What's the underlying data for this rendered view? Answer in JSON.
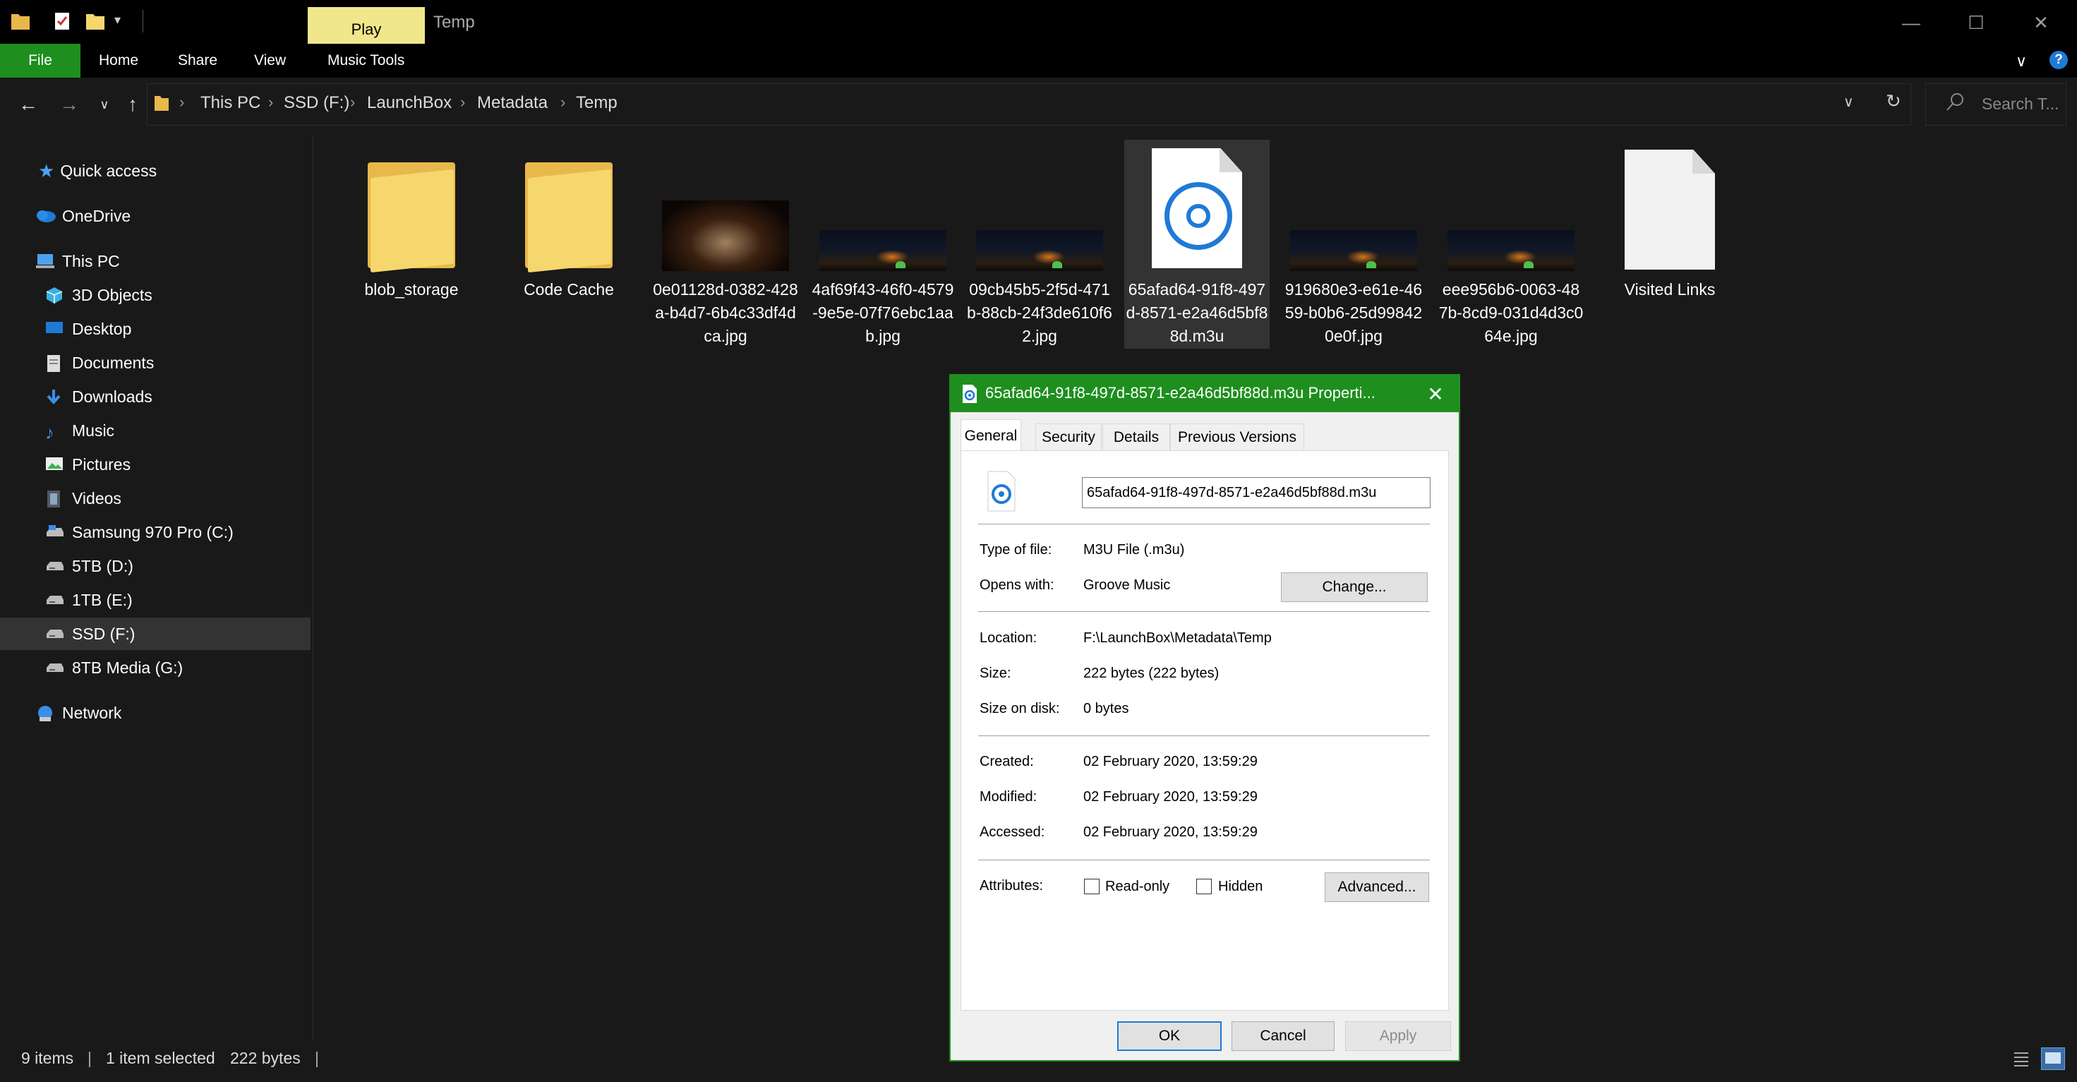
{
  "window": {
    "title": "Temp",
    "contextual_tab": "Play",
    "controls": [
      "minimize",
      "maximize",
      "close"
    ]
  },
  "ribbon": {
    "tabs": [
      "File",
      "Home",
      "Share",
      "View",
      "Music Tools"
    ]
  },
  "address": {
    "crumbs": [
      "This PC",
      "SSD (F:)",
      "LaunchBox",
      "Metadata",
      "Temp"
    ],
    "search_placeholder": "Search T..."
  },
  "sidebar": {
    "items": [
      {
        "label": "Quick access",
        "icon": "star-icon"
      },
      {
        "label": "OneDrive",
        "icon": "cloud-icon"
      },
      {
        "label": "This PC",
        "icon": "computer-icon"
      },
      {
        "label": "3D Objects",
        "icon": "cube-icon"
      },
      {
        "label": "Desktop",
        "icon": "desktop-icon"
      },
      {
        "label": "Documents",
        "icon": "documents-icon"
      },
      {
        "label": "Downloads",
        "icon": "download-arrow-icon"
      },
      {
        "label": "Music",
        "icon": "music-note-icon"
      },
      {
        "label": "Pictures",
        "icon": "pictures-icon"
      },
      {
        "label": "Videos",
        "icon": "film-icon"
      },
      {
        "label": "Samsung 970 Pro (C:)",
        "icon": "drive-icon"
      },
      {
        "label": "5TB (D:)",
        "icon": "drive-icon"
      },
      {
        "label": "1TB (E:)",
        "icon": "drive-icon"
      },
      {
        "label": "SSD (F:)",
        "icon": "drive-icon",
        "selected": true
      },
      {
        "label": "8TB Media (G:)",
        "icon": "drive-icon"
      },
      {
        "label": "Network",
        "icon": "network-icon"
      }
    ]
  },
  "files": [
    {
      "name": "blob_storage",
      "kind": "folder"
    },
    {
      "name": "Code Cache",
      "kind": "folder"
    },
    {
      "name": "0e01128d-0382-428a-b4d7-6b4c33df4dca.jpg",
      "kind": "image"
    },
    {
      "name": "4af69f43-46f0-4579-9e5e-07f76ebc1aab.jpg",
      "kind": "image"
    },
    {
      "name": "09cb45b5-2f5d-471b-88cb-24f3de610f62.jpg",
      "kind": "image"
    },
    {
      "name": "65afad64-91f8-497d-8571-e2a46d5bf88d.m3u",
      "kind": "playlist",
      "selected": true
    },
    {
      "name": "919680e3-e61e-4659-b0b6-25d998420e0f.jpg",
      "kind": "image"
    },
    {
      "name": "eee956b6-0063-487b-8cd9-031d4d3c064e.jpg",
      "kind": "image"
    },
    {
      "name": "Visited Links",
      "kind": "file"
    }
  ],
  "status": {
    "count": "9 items",
    "selection": "1 item selected",
    "size": "222 bytes"
  },
  "dialog": {
    "title": "65afad64-91f8-497d-8571-e2a46d5bf88d.m3u Properti...",
    "tabs": [
      "General",
      "Security",
      "Details",
      "Previous Versions"
    ],
    "active_tab": "General",
    "filename": "65afad64-91f8-497d-8571-e2a46d5bf88d.m3u",
    "type_label": "Type of file:",
    "type_value": "M3U File (.m3u)",
    "opens_label": "Opens with:",
    "opens_value": "Groove Music",
    "change_button": "Change...",
    "location_label": "Location:",
    "location_value": "F:\\LaunchBox\\Metadata\\Temp",
    "size_label": "Size:",
    "size_value": "222 bytes (222 bytes)",
    "size_disk_label": "Size on disk:",
    "size_disk_value": "0 bytes",
    "created_label": "Created:",
    "created_value": "02 February 2020, 13:59:29",
    "modified_label": "Modified:",
    "modified_value": "02 February 2020, 13:59:29",
    "accessed_label": "Accessed:",
    "accessed_value": "02 February 2020, 13:59:29",
    "attributes_label": "Attributes:",
    "readonly_label": "Read-only",
    "hidden_label": "Hidden",
    "advanced_button": "Advanced...",
    "ok_button": "OK",
    "cancel_button": "Cancel",
    "apply_button": "Apply"
  },
  "colors": {
    "accent_green": "#1e8f1e",
    "play_tab": "#f0e68c",
    "background": "#191919",
    "selection": "#333333"
  }
}
